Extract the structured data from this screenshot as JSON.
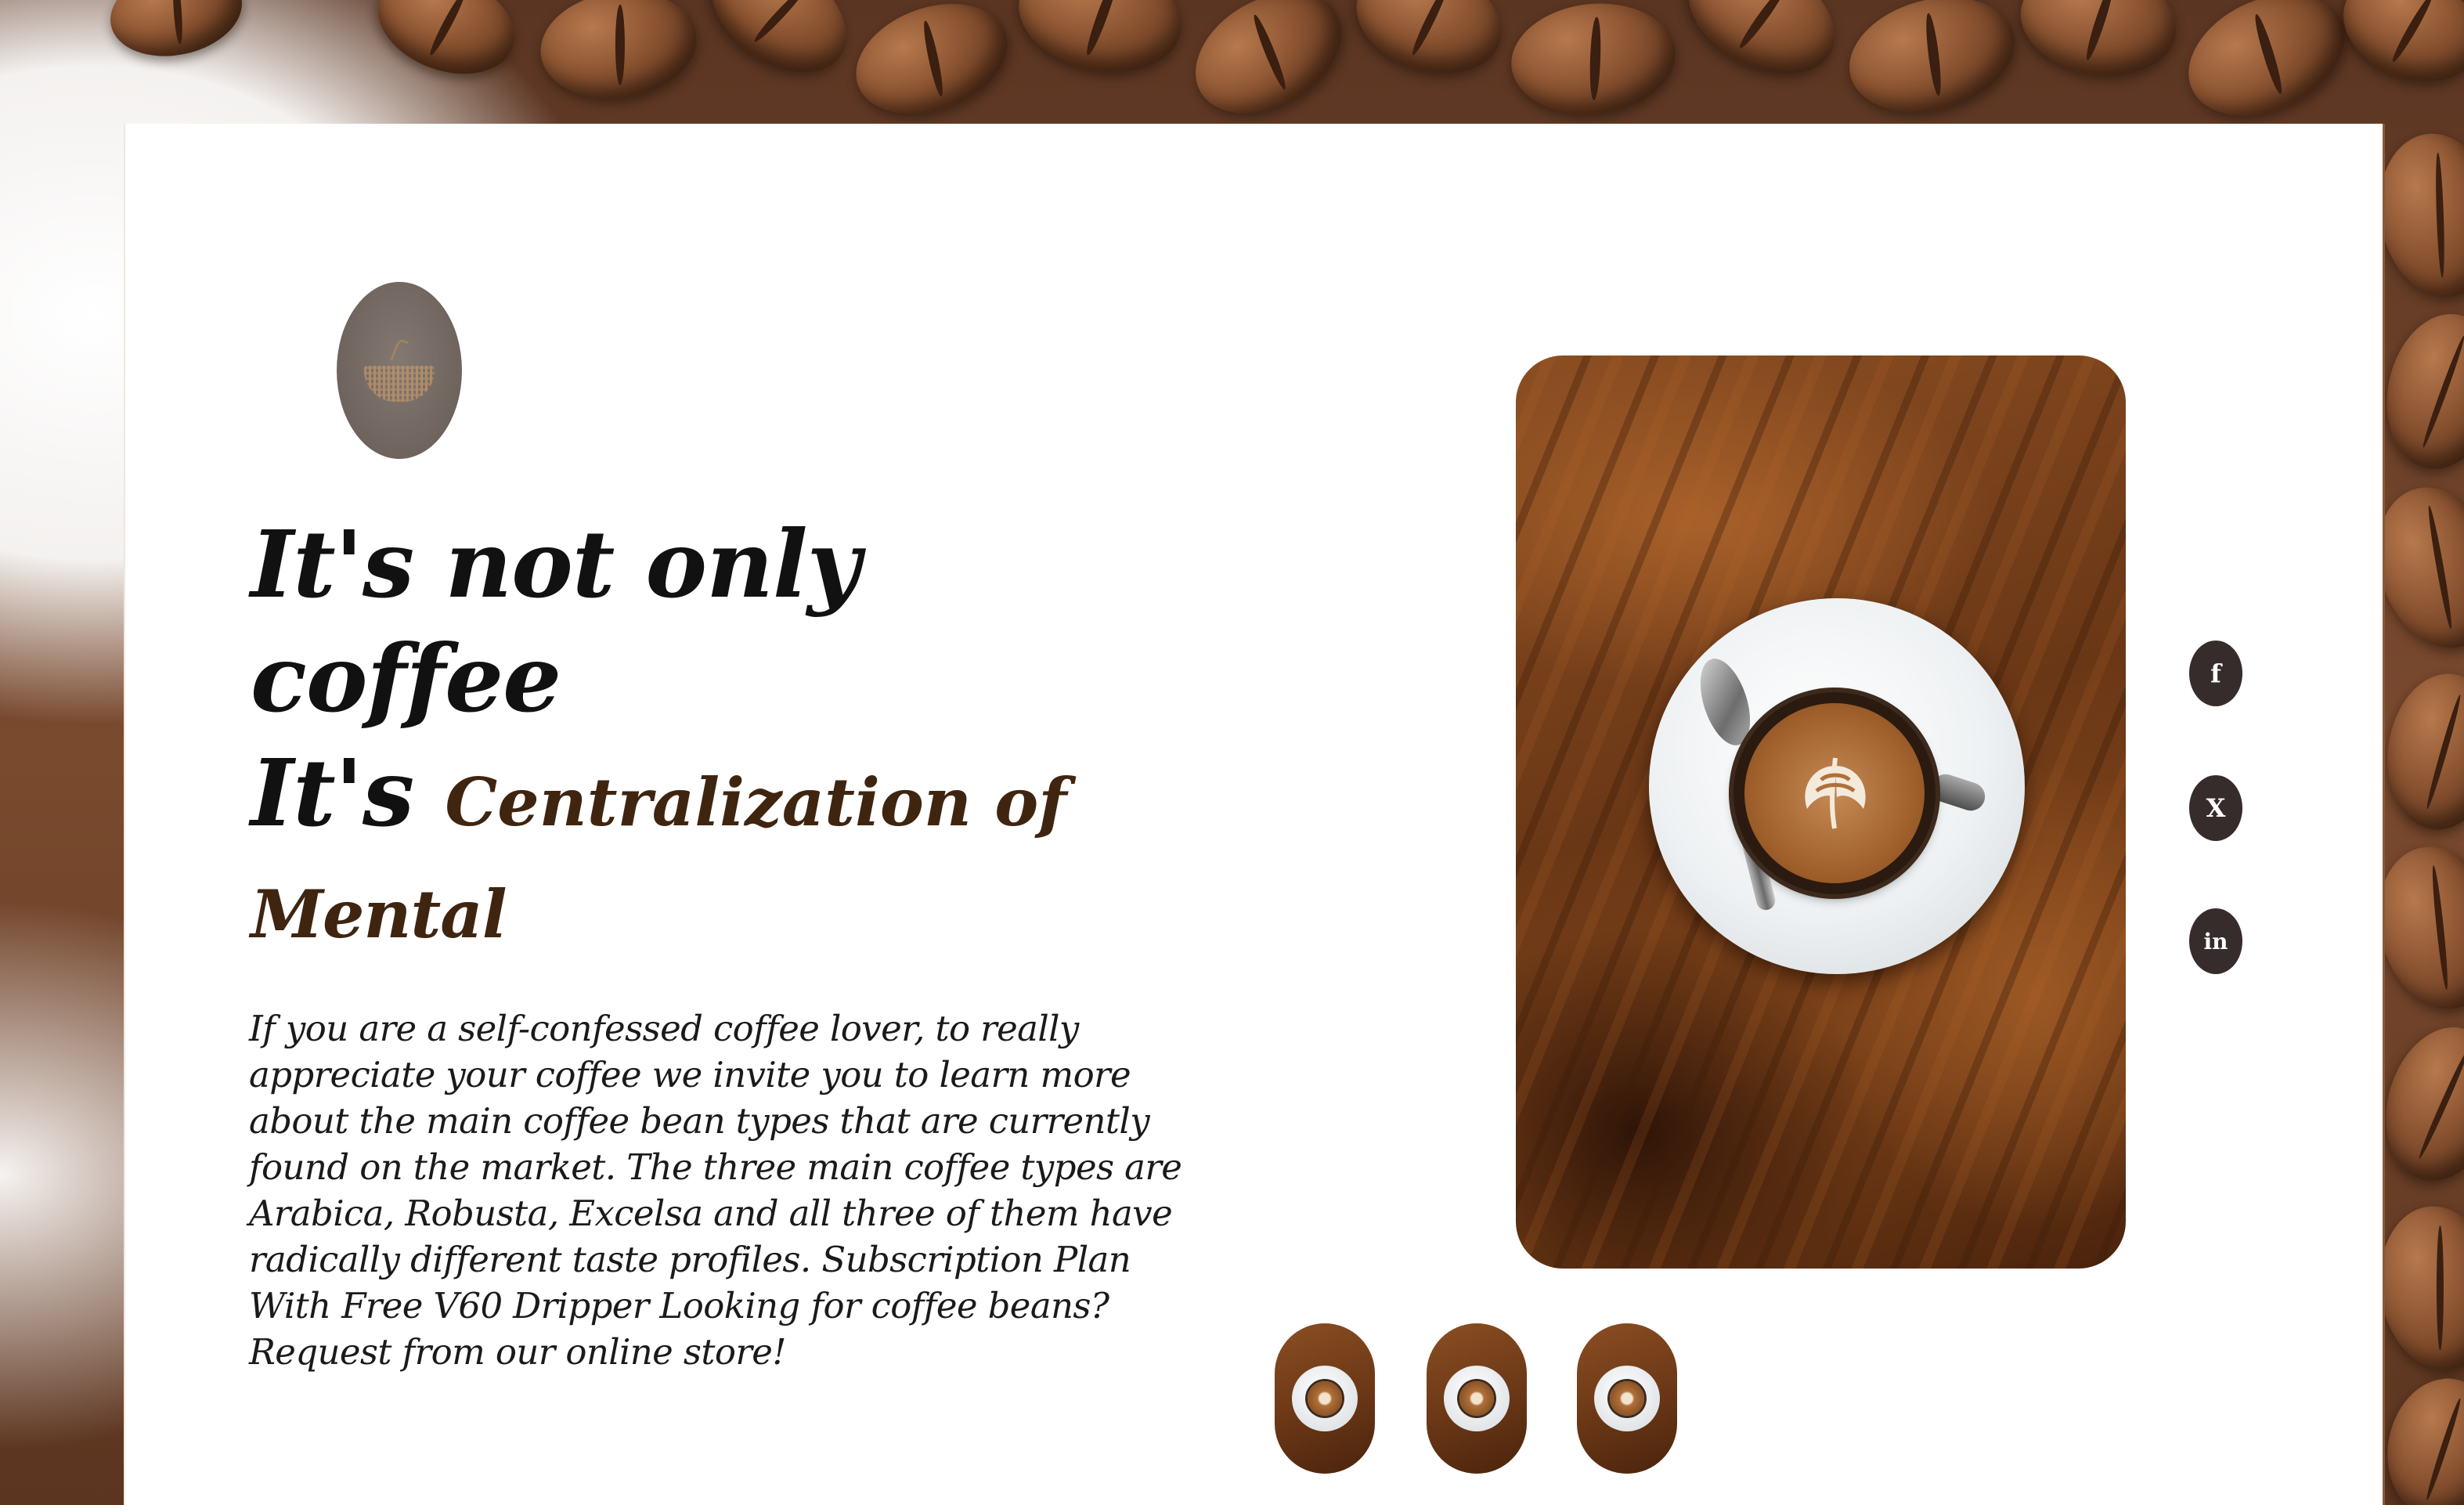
{
  "page": {
    "background": "coffee-beans",
    "panel_color": "#ffffff",
    "accent_color": "#3f2510"
  },
  "logo": {
    "icon": "coffee-cup-logo-icon"
  },
  "headline": {
    "line1": "It's not only",
    "line2": "coffee",
    "line3_lead": "It's",
    "line3_accent": "Centralization of",
    "line4": "Mental"
  },
  "body_text": "If you are a self-confessed coffee lover, to really appreciate your coffee we invite you to learn more about the main coffee bean types that are currently found on the market. The three main coffee types are Arabica, Robusta, Excelsa and all three of them have radically different taste profiles. Subscription Plan With Free V60 Dripper Looking for coffee beans? Request from our online store!",
  "hero_image": {
    "subject": "latte-art cup on saucer over wooden table"
  },
  "thumbnails": [
    {
      "subject": "latte-cup-thumbnail"
    },
    {
      "subject": "latte-cup-thumbnail"
    },
    {
      "subject": "latte-cup-thumbnail"
    }
  ],
  "social": [
    {
      "label": "f",
      "icon": "facebook-icon"
    },
    {
      "label": "X",
      "icon": "x-twitter-icon"
    },
    {
      "label": "in",
      "icon": "linkedin-icon"
    }
  ]
}
